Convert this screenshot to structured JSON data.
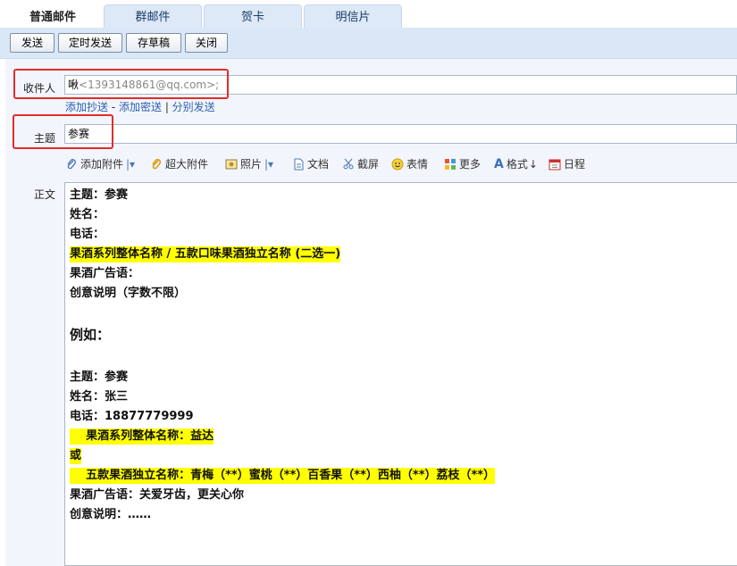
{
  "tabs": [
    "普通邮件",
    "群邮件",
    "贺卡",
    "明信片"
  ],
  "toolbar": {
    "send": "发送",
    "scheduled": "定时发送",
    "draft": "存草稿",
    "close": "关闭"
  },
  "recipient": {
    "label": "收件人",
    "name": "啾",
    "email": "<1393148861@qq.com>;"
  },
  "cc_links": {
    "add_cc": "添加抄送",
    "sep1": " - ",
    "add_bcc": "添加密送",
    "sep2": " | ",
    "separate": "分别发送"
  },
  "subject": {
    "label": "主题",
    "value": "参赛"
  },
  "attach_toolbar": {
    "attach": "添加附件",
    "big_attach": "超大附件",
    "photo": "照片",
    "doc": "文档",
    "screenshot": "截屏",
    "emoji": "表情",
    "more": "更多",
    "format": "格式",
    "schedule": "日程"
  },
  "body_label": "正文",
  "body_lines": [
    "主题：参赛",
    "姓名：",
    "电话：",
    "果酒系列整体名称 / 五款口味果酒独立名称 (二选一)",
    "果酒广告语：",
    "创意说明（字数不限）",
    "例如：",
    "主题：参赛",
    "姓名：张三",
    "电话：18877779999",
    "    果酒系列整体名称：益达",
    "或",
    "    五款果酒独立名称：青梅（**）蜜桃（**）百香果（**）西柚（**）荔枝（**）",
    "果酒广告语：关爱牙齿，更关心你",
    "创意说明：……"
  ],
  "colors": {
    "highlight": "#ffff00",
    "annotation": "#e32b2b",
    "toolbar_bg": "#dae7f6"
  }
}
